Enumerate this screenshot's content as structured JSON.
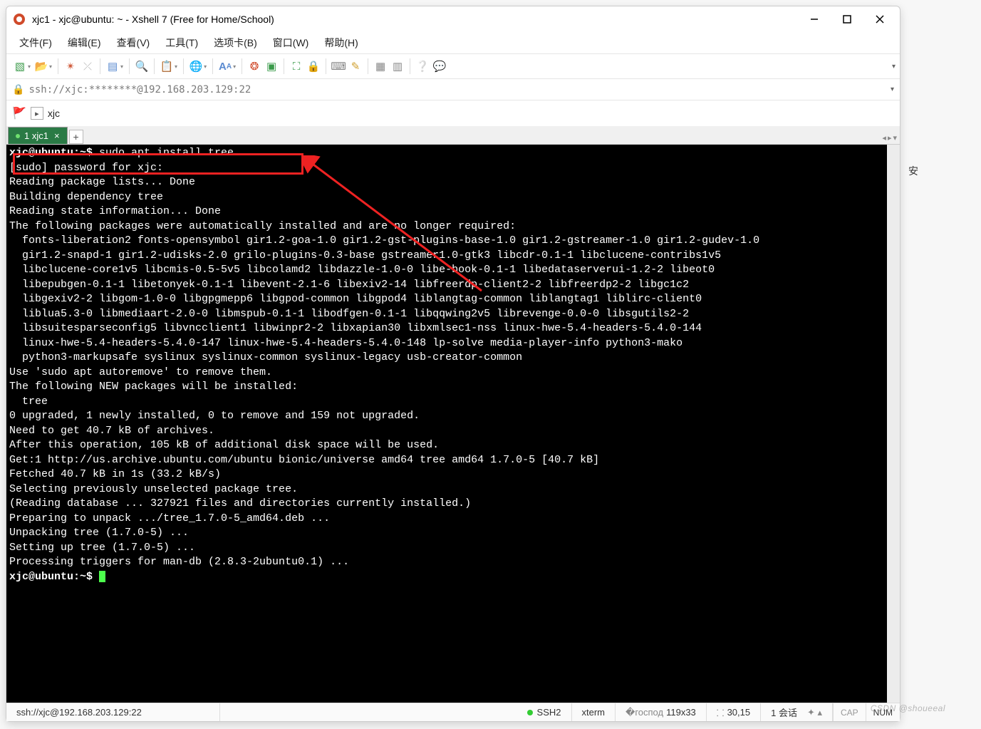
{
  "title": "xjc1 - xjc@ubuntu: ~ - Xshell 7 (Free for Home/School)",
  "menu": [
    "文件(F)",
    "编辑(E)",
    "查看(V)",
    "工具(T)",
    "选项卡(B)",
    "窗口(W)",
    "帮助(H)"
  ],
  "address": "ssh://xjc:********@192.168.203.129:22",
  "session_label": "xjc",
  "tab": {
    "label": "1 xjc1"
  },
  "terminal": {
    "prompt1": "xjc@ubuntu:~$ ",
    "cmd1": "sudo apt install tree",
    "lines": [
      "[sudo] password for xjc: ",
      "Reading package lists... Done",
      "Building dependency tree       ",
      "Reading state information... Done",
      "The following packages were automatically installed and are no longer required:",
      "  fonts-liberation2 fonts-opensymbol gir1.2-goa-1.0 gir1.2-gst-plugins-base-1.0 gir1.2-gstreamer-1.0 gir1.2-gudev-1.0",
      "  gir1.2-snapd-1 gir1.2-udisks-2.0 grilo-plugins-0.3-base gstreamer1.0-gtk3 libcdr-0.1-1 libclucene-contribs1v5",
      "  libclucene-core1v5 libcmis-0.5-5v5 libcolamd2 libdazzle-1.0-0 libe-book-0.1-1 libedataserverui-1.2-2 libeot0",
      "  libepubgen-0.1-1 libetonyek-0.1-1 libevent-2.1-6 libexiv2-14 libfreerdp-client2-2 libfreerdp2-2 libgc1c2",
      "  libgexiv2-2 libgom-1.0-0 libgpgmepp6 libgpod-common libgpod4 liblangtag-common liblangtag1 liblirc-client0",
      "  liblua5.3-0 libmediaart-2.0-0 libmspub-0.1-1 libodfgen-0.1-1 libqqwing2v5 librevenge-0.0-0 libsgutils2-2",
      "  libsuitesparseconfig5 libvncclient1 libwinpr2-2 libxapian30 libxmlsec1-nss linux-hwe-5.4-headers-5.4.0-144",
      "  linux-hwe-5.4-headers-5.4.0-147 linux-hwe-5.4-headers-5.4.0-148 lp-solve media-player-info python3-mako",
      "  python3-markupsafe syslinux syslinux-common syslinux-legacy usb-creator-common",
      "Use 'sudo apt autoremove' to remove them.",
      "The following NEW packages will be installed:",
      "  tree",
      "0 upgraded, 1 newly installed, 0 to remove and 159 not upgraded.",
      "Need to get 40.7 kB of archives.",
      "After this operation, 105 kB of additional disk space will be used.",
      "Get:1 http://us.archive.ubuntu.com/ubuntu bionic/universe amd64 tree amd64 1.7.0-5 [40.7 kB]",
      "Fetched 40.7 kB in 1s (33.2 kB/s)",
      "Selecting previously unselected package tree.",
      "(Reading database ... 327921 files and directories currently installed.)",
      "Preparing to unpack .../tree_1.7.0-5_amd64.deb ...",
      "Unpacking tree (1.7.0-5) ...",
      "Setting up tree (1.7.0-5) ...",
      "Processing triggers for man-db (2.8.3-2ubuntu0.1) ..."
    ],
    "prompt2": "xjc@ubuntu:~$ "
  },
  "status": {
    "left": "ssh://xjc@192.168.203.129:22",
    "ssh": "SSH2",
    "term": "xterm",
    "size": "119x33",
    "pos": "30,15",
    "sessions": "1 会话",
    "cap": "CAP",
    "num": "NUM"
  },
  "side_char": "安",
  "watermark": "CSDN @shoueeal"
}
